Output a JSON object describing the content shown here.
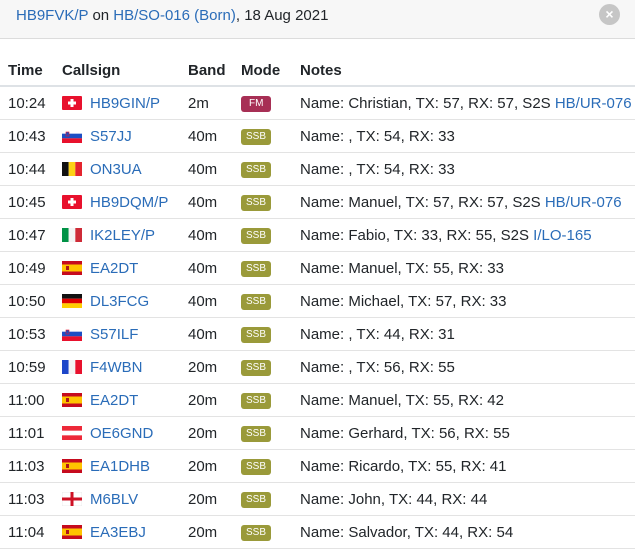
{
  "header": {
    "callsign": "HB9FVK/P",
    "on_word": "on",
    "summit": "HB/SO-016 (Born)",
    "date_sep": ", ",
    "date": "18 Aug 2021",
    "close_glyph": "×"
  },
  "columns": [
    "Time",
    "Callsign",
    "Band",
    "Mode",
    "Notes"
  ],
  "colors": {
    "link": "#2a6cb8",
    "fm_badge": "#a72f55",
    "ssb_badge": "#9a9a3a"
  },
  "rows": [
    {
      "time": "10:24",
      "callsign": "HB9GIN/P",
      "country": "Switzerland",
      "band": "2m",
      "mode": "FM",
      "notes": "Name: Christian, TX: 57, RX: 57, S2S ",
      "s2s": "HB/UR-076"
    },
    {
      "time": "10:43",
      "callsign": "S57JJ",
      "country": "Slovenia",
      "band": "40m",
      "mode": "SSB",
      "notes": "Name: , TX: 54, RX: 33",
      "s2s": ""
    },
    {
      "time": "10:44",
      "callsign": "ON3UA",
      "country": "Belgium",
      "band": "40m",
      "mode": "SSB",
      "notes": "Name: , TX: 54, RX: 33",
      "s2s": ""
    },
    {
      "time": "10:45",
      "callsign": "HB9DQM/P",
      "country": "Switzerland",
      "band": "40m",
      "mode": "SSB",
      "notes": "Name: Manuel, TX: 57, RX: 57, S2S ",
      "s2s": "HB/UR-076"
    },
    {
      "time": "10:47",
      "callsign": "IK2LEY/P",
      "country": "Italy",
      "band": "40m",
      "mode": "SSB",
      "notes": "Name: Fabio, TX: 33, RX: 55, S2S ",
      "s2s": "I/LO-165"
    },
    {
      "time": "10:49",
      "callsign": "EA2DT",
      "country": "Spain",
      "band": "40m",
      "mode": "SSB",
      "notes": "Name: Manuel, TX: 55, RX: 33",
      "s2s": ""
    },
    {
      "time": "10:50",
      "callsign": "DL3FCG",
      "country": "Germany",
      "band": "40m",
      "mode": "SSB",
      "notes": "Name: Michael, TX: 57, RX: 33",
      "s2s": ""
    },
    {
      "time": "10:53",
      "callsign": "S57ILF",
      "country": "Slovenia",
      "band": "40m",
      "mode": "SSB",
      "notes": "Name: , TX: 44, RX: 31",
      "s2s": ""
    },
    {
      "time": "10:59",
      "callsign": "F4WBN",
      "country": "France",
      "band": "20m",
      "mode": "SSB",
      "notes": "Name: , TX: 56, RX: 55",
      "s2s": ""
    },
    {
      "time": "11:00",
      "callsign": "EA2DT",
      "country": "Spain",
      "band": "20m",
      "mode": "SSB",
      "notes": "Name: Manuel, TX: 55, RX: 42",
      "s2s": ""
    },
    {
      "time": "11:01",
      "callsign": "OE6GND",
      "country": "Austria",
      "band": "20m",
      "mode": "SSB",
      "notes": "Name: Gerhard, TX: 56, RX: 55",
      "s2s": ""
    },
    {
      "time": "11:03",
      "callsign": "EA1DHB",
      "country": "Spain",
      "band": "20m",
      "mode": "SSB",
      "notes": "Name: Ricardo, TX: 55, RX: 41",
      "s2s": ""
    },
    {
      "time": "11:03",
      "callsign": "M6BLV",
      "country": "England",
      "band": "20m",
      "mode": "SSB",
      "notes": "Name: John, TX: 44, RX: 44",
      "s2s": ""
    },
    {
      "time": "11:04",
      "callsign": "EA3EBJ",
      "country": "Spain",
      "band": "20m",
      "mode": "SSB",
      "notes": "Name: Salvador, TX: 44, RX: 54",
      "s2s": ""
    }
  ]
}
